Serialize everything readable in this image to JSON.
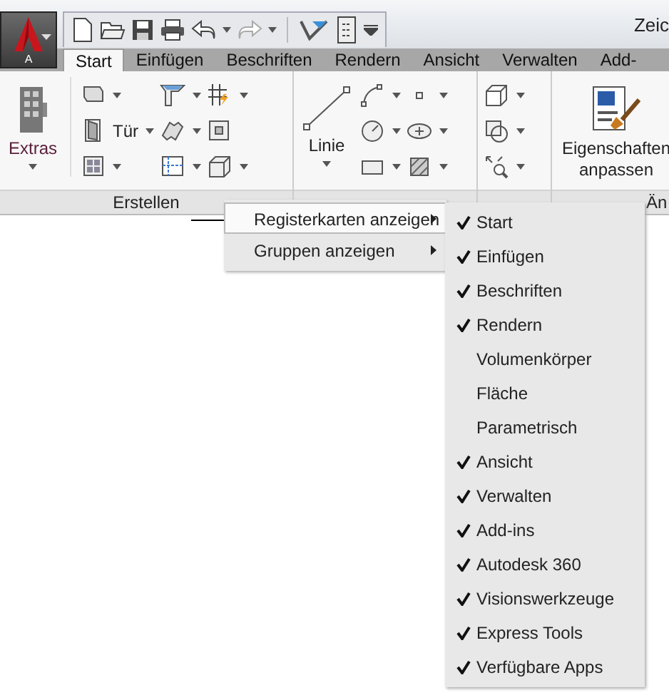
{
  "app_button": {
    "label": "A"
  },
  "title": "Zeic",
  "tabs": [
    {
      "label": "Start",
      "selected": true
    },
    {
      "label": "Einfügen",
      "selected": false
    },
    {
      "label": "Beschriften",
      "selected": false
    },
    {
      "label": "Rendern",
      "selected": false
    },
    {
      "label": "Ansicht",
      "selected": false
    },
    {
      "label": "Verwalten",
      "selected": false
    },
    {
      "label": "Add-",
      "selected": false
    }
  ],
  "ribbon": {
    "panels": [
      {
        "kind": "create",
        "title": "Erstellen",
        "large_button": "Extras",
        "tool_label": "Tür"
      },
      {
        "kind": "draw",
        "large_button": "Linie"
      },
      {
        "kind": "view"
      },
      {
        "kind": "modify",
        "title": "Än",
        "large_button": "Eigenschaften anpassen"
      }
    ]
  },
  "context_menu": {
    "items": [
      {
        "label": "Registerkarten anzeigen",
        "selected": true
      },
      {
        "label": "Gruppen anzeigen",
        "selected": false
      }
    ]
  },
  "submenu": {
    "items": [
      {
        "label": "Start",
        "checked": true
      },
      {
        "label": "Einfügen",
        "checked": true
      },
      {
        "label": "Beschriften",
        "checked": true
      },
      {
        "label": "Rendern",
        "checked": true
      },
      {
        "label": "Volumenkörper",
        "checked": false
      },
      {
        "label": "Fläche",
        "checked": false
      },
      {
        "label": "Parametrisch",
        "checked": false
      },
      {
        "label": "Ansicht",
        "checked": true
      },
      {
        "label": "Verwalten",
        "checked": true
      },
      {
        "label": "Add-ins",
        "checked": true
      },
      {
        "label": "Autodesk 360",
        "checked": true
      },
      {
        "label": "Visionswerkzeuge",
        "checked": true
      },
      {
        "label": "Express Tools",
        "checked": true
      },
      {
        "label": "Verfügbare Apps",
        "checked": true
      }
    ]
  }
}
